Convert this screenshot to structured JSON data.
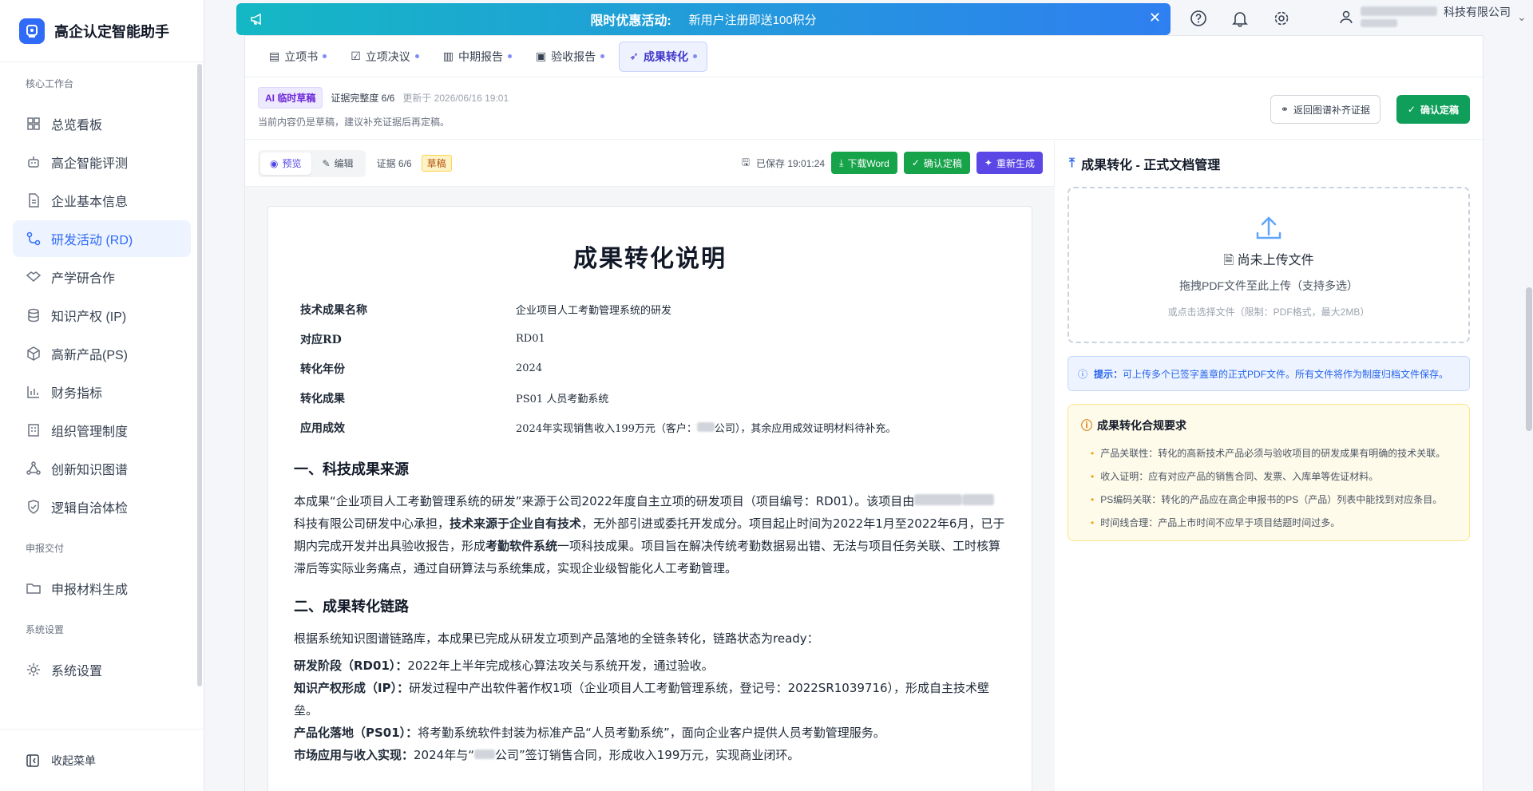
{
  "app": {
    "title": "高企认定智能助手"
  },
  "sidebar": {
    "sections": [
      {
        "title": "核心工作台",
        "items": [
          {
            "label": "总览看板",
            "icon": "dashboard-icon"
          },
          {
            "label": "高企智能评测",
            "icon": "robot-icon"
          },
          {
            "label": "企业基本信息",
            "icon": "document-icon"
          },
          {
            "label": "研发活动 (RD)",
            "icon": "flow-icon",
            "active": true
          },
          {
            "label": "产学研合作",
            "icon": "handshake-icon"
          },
          {
            "label": "知识产权 (IP)",
            "icon": "database-icon"
          },
          {
            "label": "高新产品(PS)",
            "icon": "box-icon"
          },
          {
            "label": "财务指标",
            "icon": "bar-chart-icon"
          },
          {
            "label": "组织管理制度",
            "icon": "building-icon"
          },
          {
            "label": "创新知识图谱",
            "icon": "graph-icon"
          },
          {
            "label": "逻辑自洽体检",
            "icon": "shield-check-icon"
          }
        ]
      },
      {
        "title": "申报交付",
        "items": [
          {
            "label": "申报材料生成",
            "icon": "folder-icon"
          }
        ]
      },
      {
        "title": "系统设置",
        "items": [
          {
            "label": "系统设置",
            "icon": "gear-icon"
          }
        ]
      }
    ],
    "collapse_label": "收起菜单"
  },
  "promo": {
    "title": "限时优惠活动:",
    "text": "新用户注册即送100积分"
  },
  "header": {
    "company_suffix": "科技有限公司"
  },
  "tabs": [
    {
      "label": "立项书"
    },
    {
      "label": "立项决议"
    },
    {
      "label": "中期报告"
    },
    {
      "label": "验收报告"
    },
    {
      "label": "成果转化",
      "active": true
    }
  ],
  "info": {
    "badge": "AI 临时草稿",
    "completeness": "证据完整度 6/6",
    "updated": "更新于 2026/06/16 19:01",
    "hint": "当前内容仍是草稿，建议补充证据后再定稿。",
    "back_button": "返回图谱补齐证据",
    "confirm_button": "确认定稿"
  },
  "toolbar": {
    "preview": "预览",
    "edit": "编辑",
    "evidence": "证据 6/6",
    "draft": "草稿",
    "saved": "已保存 19:01:24",
    "download": "下载Word",
    "confirm": "确认定稿",
    "regenerate": "重新生成"
  },
  "doc": {
    "title": "成果转化说明",
    "fields": [
      {
        "k": "技术成果名称",
        "v": "企业项目人工考勤管理系统的研发"
      },
      {
        "k": "对应RD",
        "v": "RD01"
      },
      {
        "k": "转化年份",
        "v": "2024"
      },
      {
        "k": "转化成果",
        "v": "PS01 人员考勤系统"
      },
      {
        "k": "应用成效",
        "v_pre": "2024年实现销售收入199万元（客户：",
        "v_post": "公司），其余应用成效证明材料待补充。"
      }
    ],
    "s1_title": "一、科技成果来源",
    "s1_a": "本成果“企业项目人工考勤管理系统的研发”来源于公司2022年度自主立项的研发项目（项目编号：RD01）。该项目由",
    "s1_b": "科技有限公司研发中心承担，",
    "s1_bold1": "技术来源于企业自有技术",
    "s1_c": "，无外部引进或委托开发成分。项目起止时间为2022年1月至2022年6月，已于期内完成开发并出具验收报告，形成",
    "s1_bold2": "考勤软件系统",
    "s1_d": "一项科技成果。项目旨在解决传统考勤数据易出错、无法与项目任务关联、工时核算滞后等实际业务痛点，通过自研算法与系统集成，实现企业级智能化人工考勤管理。",
    "s2_title": "二、成果转化链路",
    "s2_intro": "根据系统知识图谱链路库，本成果已完成从研发立项到产品落地的全链条转化，链路状态为ready：",
    "chain": [
      {
        "b": "研发阶段（RD01）：",
        "t": "2022年上半年完成核心算法攻关与系统开发，通过验收。"
      },
      {
        "b": "知识产权形成（IP）：",
        "t": "研发过程中产出软件著作权1项（企业项目人工考勤管理系统，登记号：2022SR1039716），形成自主技术壁垒。"
      },
      {
        "b": "产品化落地（PS01）：",
        "t": "将考勤系统软件封装为标准产品“人员考勤系统”，面向企业客户提供人员考勤管理服务。"
      },
      {
        "b": "市场应用与收入实现：",
        "t_pre": "2024年与“",
        "t_post": "公司”签订销售合同，形成收入199万元，实现商业闭环。"
      }
    ]
  },
  "right": {
    "title": "成果转化 - 正式文档管理",
    "upload_state": "尚未上传文件",
    "upload_hint": "拖拽PDF文件至此上传（支持多选）",
    "upload_sub": "或点击选择文件（限制：PDF格式，最大2MB）",
    "tip_label": "提示：",
    "tip": "可上传多个已签字盖章的正式PDF文件。所有文件将作为制度归档文件保存。",
    "rules_title": "成果转化合规要求",
    "rules": [
      "产品关联性：转化的高新技术产品必须与验收项目的研发成果有明确的技术关联。",
      "收入证明：应有对应产品的销售合同、发票、入库单等佐证材料。",
      "PS编码关联：转化的产品应在高企申报书的PS（产品）列表中能找到对应条目。",
      "时间线合理：产品上市时间不应早于项目结题时间过多。"
    ]
  },
  "colors": {
    "accent": "#2f6bf6",
    "green": "#0f9f5a",
    "purple": "#5b46e6"
  }
}
